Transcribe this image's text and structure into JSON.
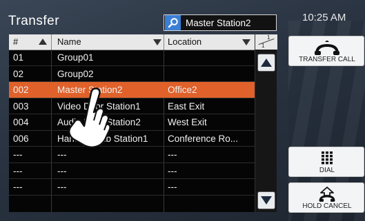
{
  "title": "Transfer",
  "search": {
    "value": "Master Station2",
    "icon": "search-icon"
  },
  "clock": "10:25 AM",
  "table": {
    "columns": [
      "#",
      "Name",
      "Location"
    ],
    "rows": [
      {
        "num": "01",
        "name": "Group01",
        "location": ""
      },
      {
        "num": "02",
        "name": "Group02",
        "location": ""
      },
      {
        "num": "002",
        "name": "Master Station2",
        "location": "Office2"
      },
      {
        "num": "003",
        "name": "Video Door Station1",
        "location": "East Exit"
      },
      {
        "num": "004",
        "name": "Audio Door Station2",
        "location": "West Exit"
      },
      {
        "num": "006",
        "name": "Handset Sub Station1",
        "location": "Conference Ro..."
      },
      {
        "num": "---",
        "name": "---",
        "location": "---"
      },
      {
        "num": "---",
        "name": "---",
        "location": "---"
      },
      {
        "num": "---",
        "name": "---",
        "location": "---"
      }
    ]
  },
  "pager": {
    "current": "1",
    "total": "1"
  },
  "buttons": {
    "transfer_call": "TRANSFER CALL",
    "dial": "DIAL",
    "hold_cancel": "HOLD CANCEL"
  },
  "colors": {
    "selected_row": "#e0612a",
    "search_icon_bg": "#3a7fd6"
  }
}
